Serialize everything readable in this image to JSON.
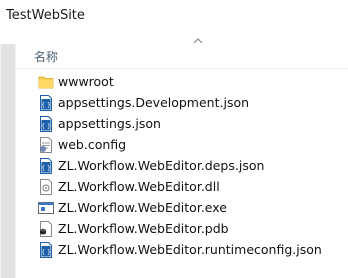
{
  "window": {
    "title": "TestWebSite"
  },
  "header": {
    "name_column": "名称"
  },
  "files": [
    {
      "name": "wwwroot",
      "icon": "folder-icon"
    },
    {
      "name": "appsettings.Development.json",
      "icon": "json-file-icon"
    },
    {
      "name": "appsettings.json",
      "icon": "json-file-icon"
    },
    {
      "name": "web.config",
      "icon": "config-file-icon"
    },
    {
      "name": "ZL.Workflow.WebEditor.deps.json",
      "icon": "json-file-icon"
    },
    {
      "name": "ZL.Workflow.WebEditor.dll",
      "icon": "dll-file-icon"
    },
    {
      "name": "ZL.Workflow.WebEditor.exe",
      "icon": "exe-file-icon"
    },
    {
      "name": "ZL.Workflow.WebEditor.pdb",
      "icon": "pdb-file-icon"
    },
    {
      "name": "ZL.Workflow.WebEditor.runtimeconfig.json",
      "icon": "json-file-icon"
    }
  ],
  "colors": {
    "folder": "#f4c84a",
    "json_blue": "#1d5fa8",
    "header_text": "#4c607a"
  }
}
